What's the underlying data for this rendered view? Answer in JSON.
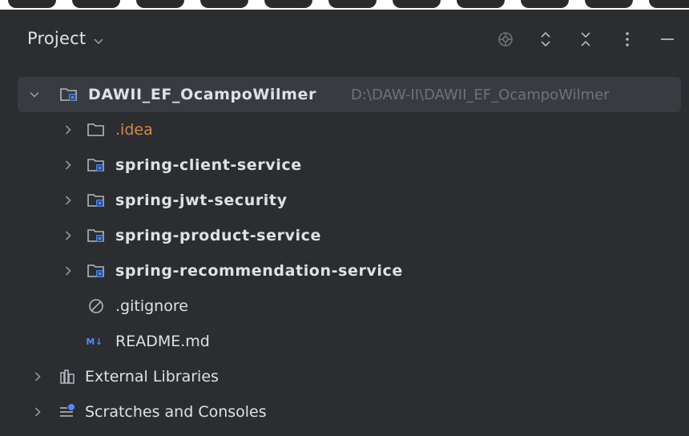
{
  "header": {
    "title": "Project",
    "actions": [
      {
        "name": "locate-icon",
        "label": "Select Opened File"
      },
      {
        "name": "expand-all-icon",
        "label": "Expand All"
      },
      {
        "name": "collapse-all-icon",
        "label": "Collapse All"
      },
      {
        "name": "more-options-icon",
        "label": "Options"
      },
      {
        "name": "hide-icon",
        "label": "Hide"
      }
    ]
  },
  "tree": {
    "root": {
      "name": "DAWII_EF_OcampoWilmer",
      "path": "D:\\DAW-II\\DAWII_EF_OcampoWilmer",
      "expanded": true
    },
    "children": [
      {
        "name": ".idea",
        "type": "folder",
        "color": "#d08a4c"
      },
      {
        "name": "spring-client-service",
        "type": "module"
      },
      {
        "name": "spring-jwt-security",
        "type": "module"
      },
      {
        "name": "spring-product-service",
        "type": "module"
      },
      {
        "name": "spring-recommendation-service",
        "type": "module"
      },
      {
        "name": ".gitignore",
        "type": "ignore-file"
      },
      {
        "name": "README.md",
        "type": "markdown-file",
        "icon_text": "M↓"
      }
    ],
    "extras": [
      {
        "name": "External Libraries",
        "icon": "library-icon"
      },
      {
        "name": "Scratches and Consoles",
        "icon": "scratches-icon"
      }
    ]
  },
  "colors": {
    "background": "#2b2d30",
    "selection": "#393b40",
    "text": "#dfe1e5",
    "muted": "#6f737a",
    "accent_blue": "#4e8bf6",
    "folder_excluded": "#d08a4c"
  }
}
